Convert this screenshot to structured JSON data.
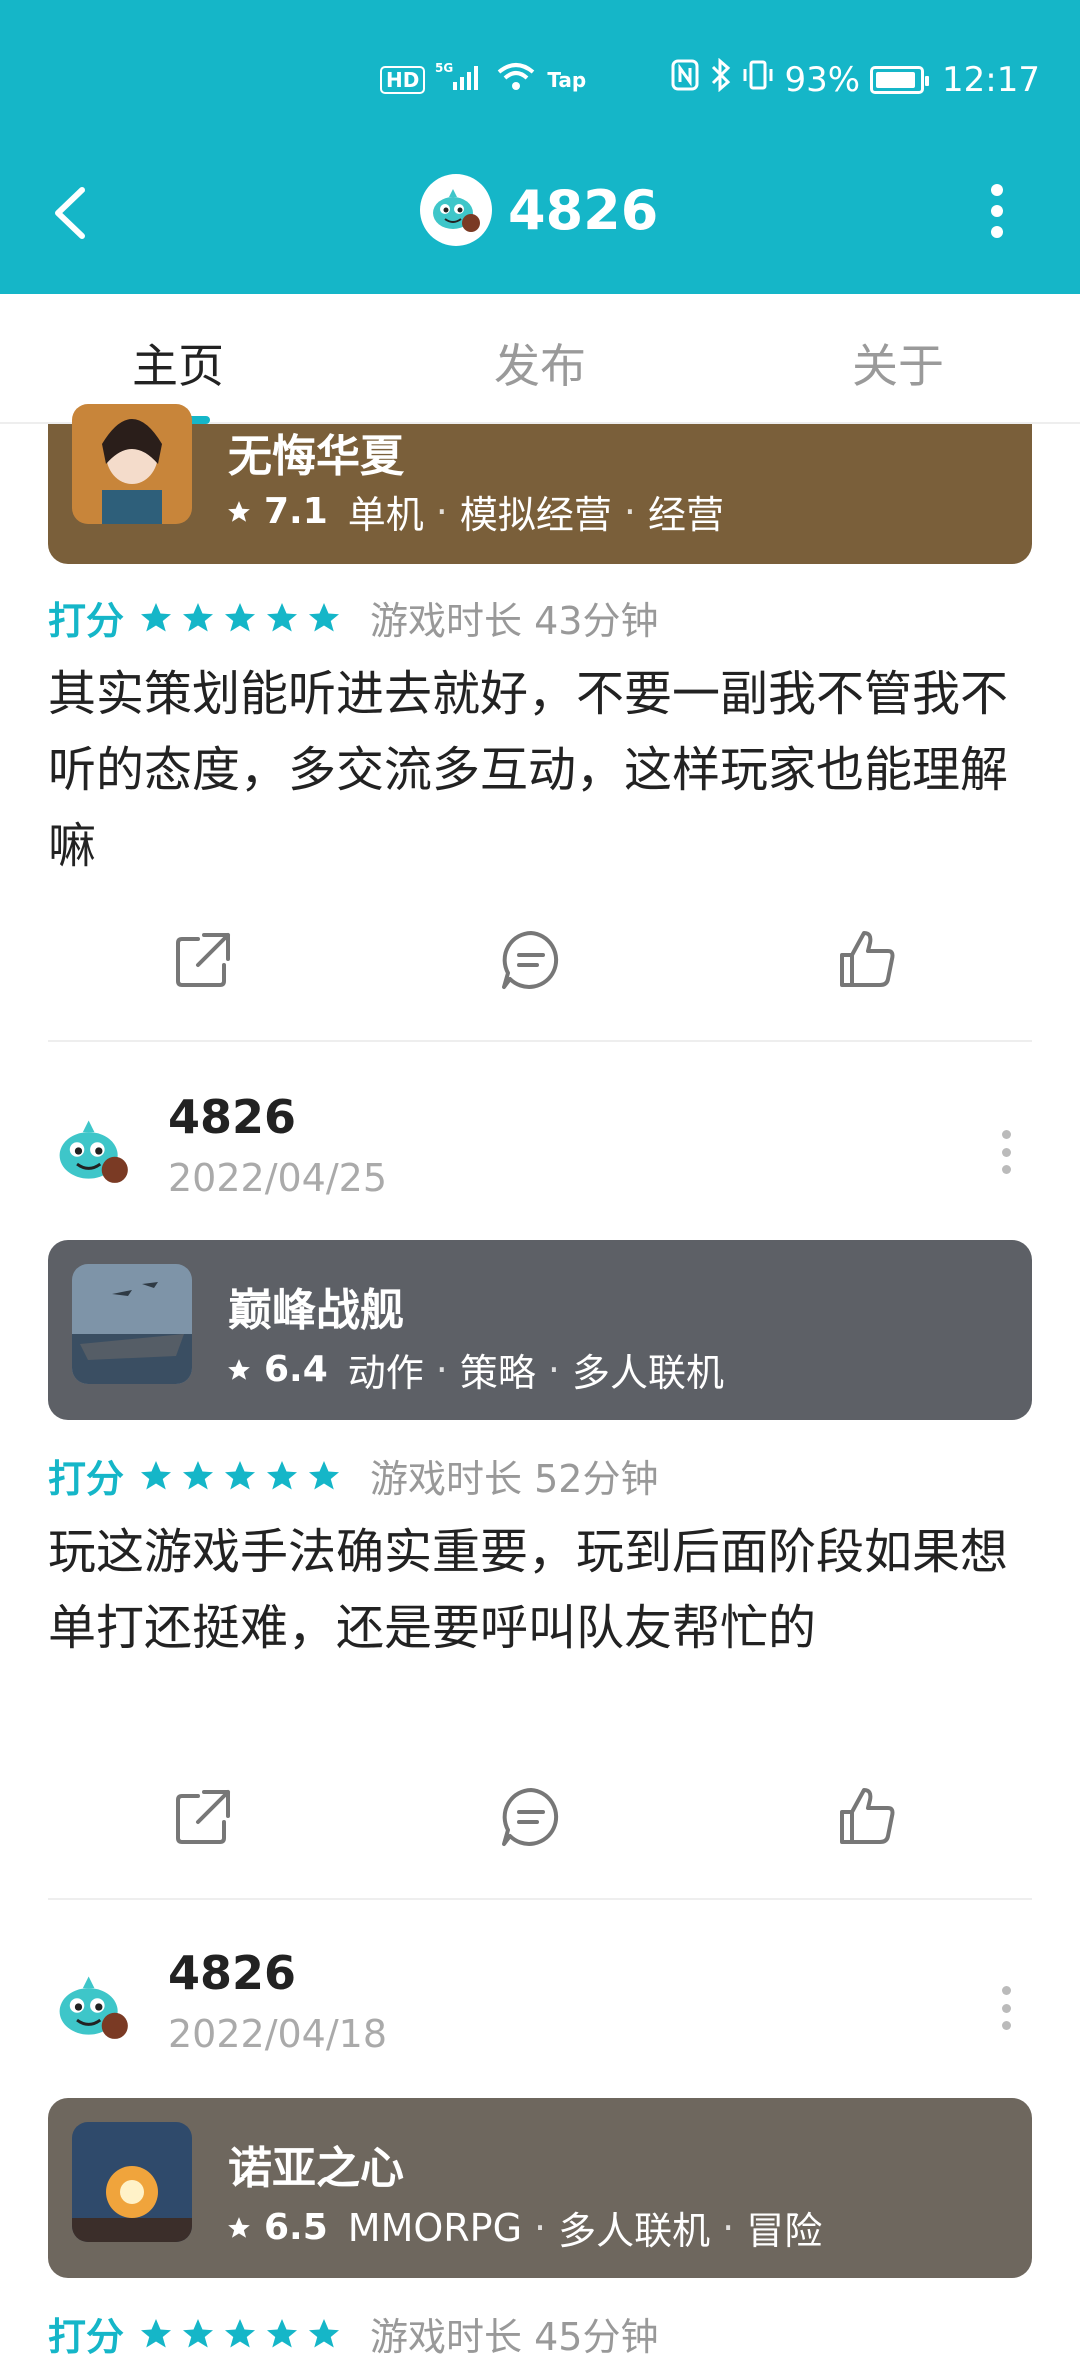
{
  "status_bar": {
    "left_hd": "HD",
    "left_net": "5G",
    "left_wifi_tag": "Tap",
    "battery": "93%",
    "time": "12:17",
    "battery_level": 0.93
  },
  "header": {
    "title": "4826"
  },
  "tabs": [
    {
      "label": "主页",
      "active": true
    },
    {
      "label": "发布",
      "active": false
    },
    {
      "label": "关于",
      "active": false
    }
  ],
  "posts": [
    {
      "game": {
        "name": "无悔华夏",
        "rating": "7.1",
        "tags": [
          "单机",
          "模拟经营",
          "经营"
        ],
        "card_color": "#7a5f3a"
      },
      "rate_label": "打分",
      "stars": 5,
      "playtime": "游戏时长 43分钟",
      "review": "其实策划能听进去就好，不要一副我不管我不听的态度，多交流多互动，这样玩家也能理解嘛"
    },
    {
      "user": "4826",
      "date": "2022/04/25",
      "game": {
        "name": "巅峰战舰",
        "rating": "6.4",
        "tags": [
          "动作",
          "策略",
          "多人联机"
        ],
        "card_color": "#5d6066"
      },
      "rate_label": "打分",
      "stars": 5,
      "playtime": "游戏时长 52分钟",
      "review": "玩这游戏手法确实重要，玩到后面阶段如果想单打还挺难，还是要呼叫队友帮忙的"
    },
    {
      "user": "4826",
      "date": "2022/04/18",
      "game": {
        "name": "诺亚之心",
        "rating": "6.5",
        "tags": [
          "MMORPG",
          "多人联机",
          "冒险"
        ],
        "card_color": "#6e675e"
      },
      "rate_label": "打分",
      "stars": 5,
      "playtime": "游戏时长 45分钟"
    }
  ],
  "colors": {
    "accent": "#15b6c8",
    "star": "#15b6c8"
  }
}
